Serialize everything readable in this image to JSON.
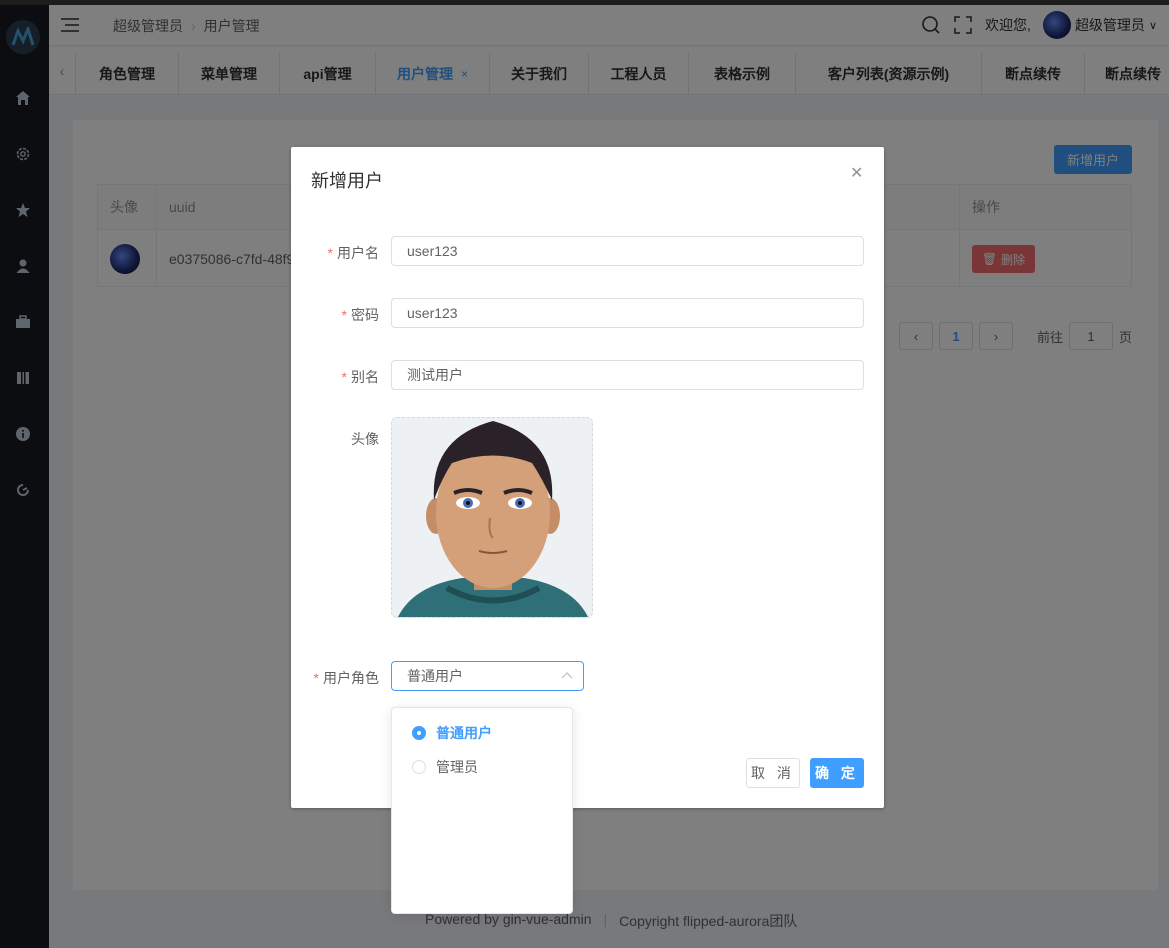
{
  "header": {
    "breadcrumb": [
      "超级管理员",
      "用户管理"
    ],
    "welcome": "欢迎您,",
    "username": "超级管理员"
  },
  "tabs": [
    {
      "label": "角色管理"
    },
    {
      "label": "菜单管理"
    },
    {
      "label": "api管理"
    },
    {
      "label": "用户管理",
      "active": true
    },
    {
      "label": "关于我们"
    },
    {
      "label": "工程人员"
    },
    {
      "label": "表格示例"
    },
    {
      "label": "客户列表(资源示例)"
    },
    {
      "label": "断点续传"
    },
    {
      "label": "断点续传"
    }
  ],
  "main": {
    "add_button": "新增用户",
    "table": {
      "headers": {
        "avatar": "头像",
        "uuid": "uuid",
        "actions": "操作"
      },
      "row": {
        "uuid": "e0375086-c7fd-48f9",
        "delete": "删除"
      }
    },
    "pager": {
      "current": "1",
      "goto": "前往",
      "page_input": "1",
      "page_unit": "页"
    }
  },
  "dialog": {
    "title": "新增用户",
    "fields": {
      "username": {
        "label": "用户名",
        "value": "user123"
      },
      "password": {
        "label": "密码",
        "value": "user123"
      },
      "nickname": {
        "label": "别名",
        "value": "测试用户"
      },
      "avatar": {
        "label": "头像"
      },
      "role": {
        "label": "用户角色",
        "value": "普通用户"
      }
    },
    "cancel": "取 消",
    "confirm": "确 定"
  },
  "dropdown": {
    "options": [
      {
        "label": "普通用户",
        "selected": true
      },
      {
        "label": "管理员",
        "selected": false
      }
    ]
  },
  "footer": {
    "powered": "Powered by  gin-vue-admin",
    "copyright": "Copyright  flipped-aurora团队"
  },
  "colors": {
    "primary": "#409eff",
    "danger": "#f56c6c",
    "sidebar": "#191a23"
  }
}
